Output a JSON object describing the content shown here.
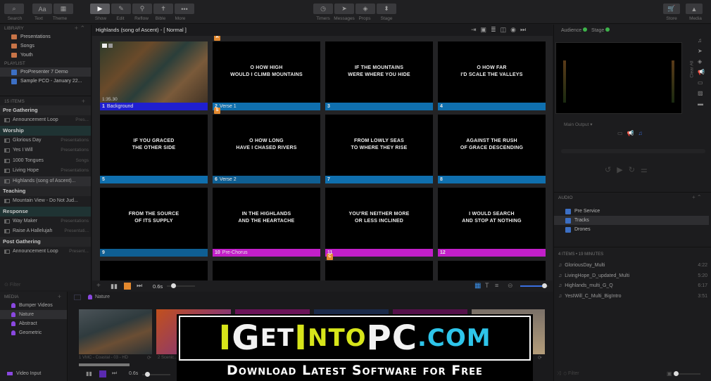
{
  "toolbar": {
    "left": [
      {
        "label": "Search",
        "icon": "search-icon"
      },
      {
        "label": "Text",
        "icon": "text-icon"
      },
      {
        "label": "Theme",
        "icon": "theme-icon"
      }
    ],
    "modes": [
      {
        "label": "Show",
        "icon": "play-icon",
        "active": true
      },
      {
        "label": "Edit",
        "icon": "pencil-icon"
      },
      {
        "label": "Reflow",
        "icon": "reflow-icon"
      },
      {
        "label": "Bible",
        "icon": "bible-icon"
      },
      {
        "label": "More",
        "icon": "ellipsis-icon"
      }
    ],
    "center": [
      {
        "label": "Timers",
        "icon": "timer-icon"
      },
      {
        "label": "Messages",
        "icon": "send-icon"
      },
      {
        "label": "Props",
        "icon": "props-icon"
      },
      {
        "label": "Stage",
        "icon": "stage-icon"
      }
    ],
    "right": [
      {
        "label": "Store",
        "icon": "cart-icon"
      },
      {
        "label": "Media",
        "icon": "media-icon"
      }
    ]
  },
  "library": {
    "header": "LIBRARY",
    "items": [
      "Presentations",
      "Songs",
      "Youth"
    ]
  },
  "playlist": {
    "header": "PLAYLIST",
    "items": [
      "ProPresenter 7 Demo",
      "Sample PCO - January 22..."
    ]
  },
  "playlist_items": {
    "count_label": "15 ITEMS",
    "groups": [
      {
        "name": "Pre Gathering",
        "rows": [
          {
            "title": "Announcement Loop",
            "library": "Pres..."
          }
        ]
      },
      {
        "name": "Worship",
        "rows": [
          {
            "title": "Glorious Day",
            "library": "Presentations"
          },
          {
            "title": "Yes I Will",
            "library": "Presentations"
          },
          {
            "title": "1000 Tongues",
            "library": "Songs"
          },
          {
            "title": "Living Hope",
            "library": "Presentations"
          },
          {
            "title": "Highlands (song of Ascent)...",
            "library": ""
          }
        ]
      },
      {
        "name": "Teaching",
        "rows": [
          {
            "title": "Mountain View - Do Not Jud...",
            "library": ""
          }
        ]
      },
      {
        "name": "Response",
        "rows": [
          {
            "title": "Way Maker",
            "library": "Presentations"
          },
          {
            "title": "Raise A Hallelujah",
            "library": "Presentati..."
          }
        ]
      },
      {
        "name": "Post Gathering",
        "rows": [
          {
            "title": "Announcement Loop",
            "library": "Present..."
          }
        ]
      }
    ],
    "filter_placeholder": "Filter"
  },
  "presentation": {
    "title": "Highlands (song of Ascent) - [ Normal ]",
    "slides": [
      {
        "num": "1",
        "label": "Background",
        "text": "",
        "color": "#1f1fd0",
        "time": "1:35.30",
        "badge": ""
      },
      {
        "num": "2",
        "label": "Verse 1",
        "text": "O HOW HIGH\nWOULD I CLIMB MOUNTAINS",
        "color": "#0f6fae",
        "badge": "A"
      },
      {
        "num": "3",
        "label": "",
        "text": "IF THE MOUNTAINS\nWERE WHERE YOU HIDE",
        "color": "#0f6fae",
        "badge": ""
      },
      {
        "num": "4",
        "label": "",
        "text": "O HOW FAR\nI'D SCALE THE VALLEYS",
        "color": "#0f6fae",
        "badge": ""
      },
      {
        "num": "5",
        "label": "",
        "text": "IF YOU GRACED\nTHE OTHER SIDE",
        "color": "#0f6fae",
        "badge": ""
      },
      {
        "num": "6",
        "label": "Verse 2",
        "text": "O HOW LONG\nHAVE I CHASED RIVERS",
        "color": "#0f5f93",
        "badge": "S"
      },
      {
        "num": "7",
        "label": "",
        "text": "FROM LOWLY SEAS\nTO WHERE THEY RISE",
        "color": "#0f6fae",
        "badge": ""
      },
      {
        "num": "8",
        "label": "",
        "text": "AGAINST THE RUSH\nOF GRACE DESCENDING",
        "color": "#0f6fae",
        "badge": ""
      },
      {
        "num": "9",
        "label": "",
        "text": "FROM THE SOURCE\nOF ITS SUPPLY",
        "color": "#0f5f93",
        "badge": ""
      },
      {
        "num": "10",
        "label": "Pre-Chorus",
        "text": "IN THE HIGHLANDS\nAND THE HEARTACHE",
        "color": "#c21fc9",
        "badge": ""
      },
      {
        "num": "11",
        "label": "",
        "text": "YOU'RE NEITHER MORE\nOR LESS INCLINED",
        "color": "#c21fc9",
        "badge": ""
      },
      {
        "num": "12",
        "label": "",
        "text": "I WOULD SEARCH\nAND STOP AT NOTHING",
        "color": "#c21fc9",
        "badge": ""
      },
      {
        "num": "",
        "label": "",
        "text": "",
        "color": "",
        "badge": ""
      },
      {
        "num": "",
        "label": "",
        "text": "",
        "color": "",
        "badge": ""
      },
      {
        "num": "",
        "label": "",
        "text": "",
        "color": "",
        "badge": "C"
      },
      {
        "num": "",
        "label": "",
        "text": "",
        "color": "",
        "badge": ""
      }
    ],
    "footer": {
      "transition_time": "0.6s",
      "zoom_level": 0.85
    }
  },
  "outputs": {
    "audience": "Audience",
    "stage": "Stage",
    "status_color": "#3db34a",
    "clear_all": "Clear All",
    "main_output": "Main Output"
  },
  "audio": {
    "header": "AUDIO",
    "playlists": [
      "Pre Service",
      "Tracks",
      "Drones"
    ],
    "summary": "4 ITEMS • 19 MINUTES",
    "tracks": [
      {
        "name": "GloriousDay_Multi",
        "duration": "4:22"
      },
      {
        "name": "LivingHope_D_updated_Multi",
        "duration": "5:20"
      },
      {
        "name": "Highlands_multi_G_Q",
        "duration": "6:17"
      },
      {
        "name": "YesIWill_C_Multi_BigIntro",
        "duration": "3:51"
      }
    ],
    "filter_placeholder": "Filter"
  },
  "media": {
    "header": "MEDIA",
    "items": [
      "Bumper Videos",
      "Nature",
      "Abstract",
      "Geometric"
    ],
    "video_input": "Video Input",
    "current_bin": "Nature",
    "thumbs": [
      {
        "label": "1 VMC - Coastal - 03 - HD"
      },
      {
        "label": "2 Scenic..."
      }
    ],
    "transition_time": "0.6s"
  },
  "watermark": {
    "line1": [
      "I",
      "G",
      "ET",
      "I",
      "NTO",
      "PC",
      ".COM"
    ],
    "line2": "Download Latest Software for Free"
  }
}
